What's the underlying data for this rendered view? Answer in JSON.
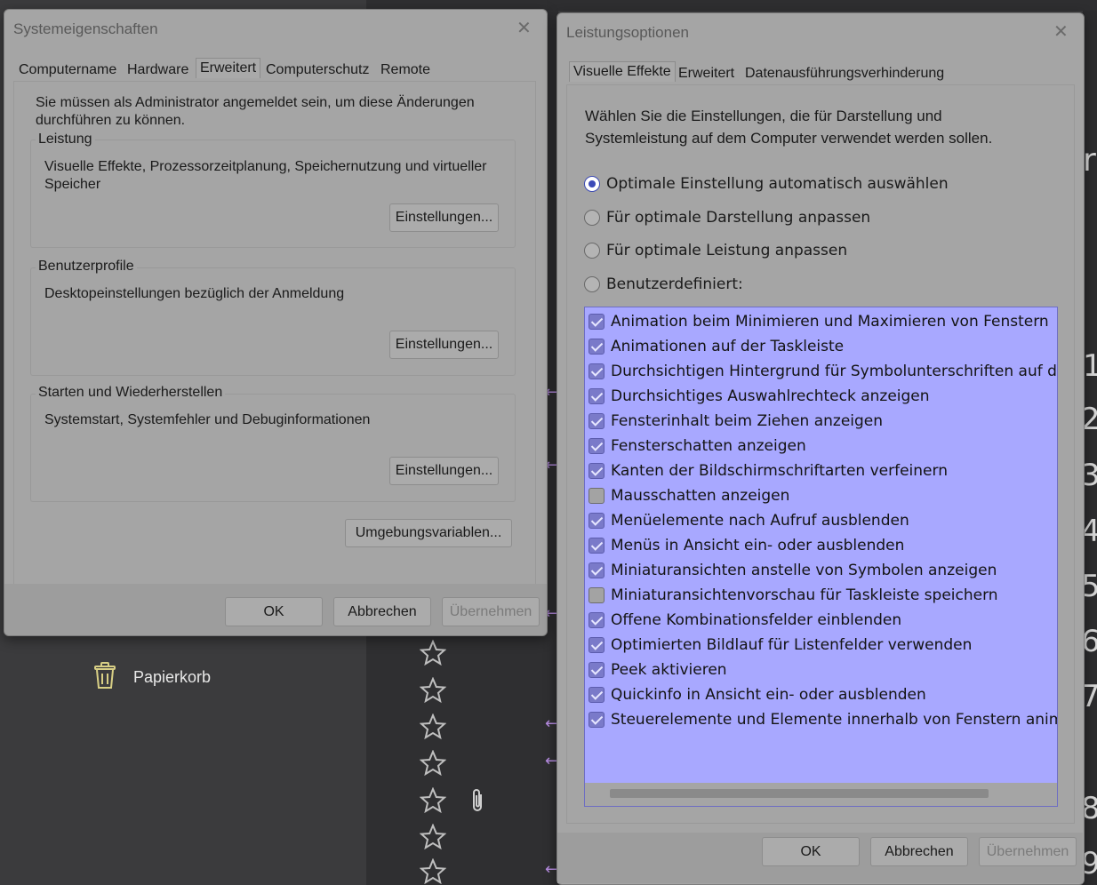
{
  "system_properties": {
    "title": "Systemeigenschaften",
    "tabs": [
      "Computername",
      "Hardware",
      "Erweitert",
      "Computerschutz",
      "Remote"
    ],
    "active_tab": "Erweitert",
    "admin_note": "Sie müssen als Administrator angemeldet sein, um diese Änderungen durchführen zu können.",
    "groups": [
      {
        "label": "Leistung",
        "description": "Visuelle Effekte, Prozessorzeitplanung, Speichernutzung und virtueller Speicher",
        "button": "Einstellungen..."
      },
      {
        "label": "Benutzerprofile",
        "description": "Desktopeinstellungen bezüglich der Anmeldung",
        "button": "Einstellungen..."
      },
      {
        "label": "Starten und Wiederherstellen",
        "description": "Systemstart, Systemfehler und Debuginformationen",
        "button": "Einstellungen..."
      }
    ],
    "env_button": "Umgebungsvariablen...",
    "footer": {
      "ok": "OK",
      "cancel": "Abbrechen",
      "apply": "Übernehmen"
    }
  },
  "performance_options": {
    "title": "Leistungsoptionen",
    "tabs": [
      "Visuelle Effekte",
      "Erweitert",
      "Datenausführungsverhinderung"
    ],
    "active_tab": "Visuelle Effekte",
    "intro": "Wählen Sie die Einstellungen, die für Darstellung und Systemleistung auf dem Computer verwendet werden sollen.",
    "radios": [
      {
        "label": "Optimale Einstellung automatisch auswählen",
        "selected": true
      },
      {
        "label": "Für optimale Darstellung anpassen",
        "selected": false
      },
      {
        "label": "Für optimale Leistung anpassen",
        "selected": false
      },
      {
        "label": "Benutzerdefiniert:",
        "selected": false
      }
    ],
    "effects": [
      {
        "label": "Animation beim Minimieren und Maximieren von Fenstern",
        "checked": true
      },
      {
        "label": "Animationen auf der Taskleiste",
        "checked": true
      },
      {
        "label": "Durchsichtigen Hintergrund für Symbolunterschriften auf dem D",
        "checked": true
      },
      {
        "label": "Durchsichtiges Auswahlrechteck anzeigen",
        "checked": true
      },
      {
        "label": "Fensterinhalt beim Ziehen anzeigen",
        "checked": true
      },
      {
        "label": "Fensterschatten anzeigen",
        "checked": true
      },
      {
        "label": "Kanten der Bildschirmschriftarten verfeinern",
        "checked": true
      },
      {
        "label": "Mausschatten anzeigen",
        "checked": false
      },
      {
        "label": "Menüelemente nach Aufruf ausblenden",
        "checked": true
      },
      {
        "label": "Menüs in Ansicht ein- oder ausblenden",
        "checked": true
      },
      {
        "label": "Miniaturansichten anstelle von Symbolen anzeigen",
        "checked": true
      },
      {
        "label": "Miniaturansichtenvorschau für Taskleiste speichern",
        "checked": false
      },
      {
        "label": "Offene Kombinationsfelder einblenden",
        "checked": true
      },
      {
        "label": "Optimierten Bildlauf für Listenfelder verwenden",
        "checked": true
      },
      {
        "label": "Peek aktivieren",
        "checked": true
      },
      {
        "label": "Quickinfo in Ansicht ein- oder ausblenden",
        "checked": true
      },
      {
        "label": "Steuerelemente und Elemente innerhalb von Fenstern animieren",
        "checked": true
      }
    ],
    "footer": {
      "ok": "OK",
      "cancel": "Abbrechen",
      "apply": "Übernehmen"
    }
  },
  "background": {
    "recycle_bin_label": "Papierkorb",
    "right_edge_glyphs": [
      "ra",
      "1",
      "2",
      "3",
      "4",
      "5",
      "6",
      "7",
      "8",
      "9"
    ]
  },
  "colors": {
    "selection": "#a8a8ff",
    "radio_accent": "#3a49b8",
    "star_outline": "#bfbfbf",
    "arrow_accent": "#b58be0"
  }
}
